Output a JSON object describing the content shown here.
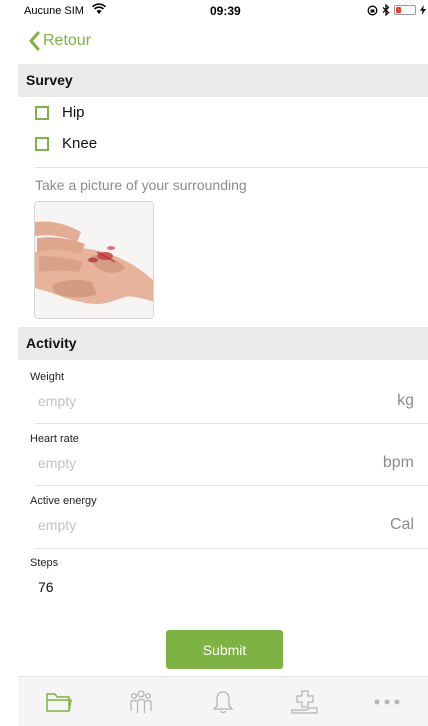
{
  "status_bar": {
    "carrier": "Aucune SIM",
    "time": "09:39",
    "battery_level": 0.2,
    "battery_color": "#ff3b30"
  },
  "nav": {
    "back_label": "Retour"
  },
  "survey": {
    "title": "Survey",
    "options": [
      {
        "label": "Hip",
        "checked": false
      },
      {
        "label": "Knee",
        "checked": false
      }
    ],
    "photo_prompt": "Take a picture of your surrounding"
  },
  "activity": {
    "title": "Activity",
    "fields": [
      {
        "label": "Weight",
        "value": "empty",
        "unit": "kg"
      },
      {
        "label": "Heart rate",
        "value": "empty",
        "unit": "bpm"
      },
      {
        "label": "Active energy",
        "value": "empty",
        "unit": "Cal"
      },
      {
        "label": "Steps",
        "value": "76",
        "unit": ""
      }
    ]
  },
  "submit_label": "Submit",
  "tabs": [
    {
      "icon": "folder-icon",
      "active": true
    },
    {
      "icon": "people-icon",
      "active": false
    },
    {
      "icon": "bell-icon",
      "active": false
    },
    {
      "icon": "medical-cross-icon",
      "active": false
    },
    {
      "icon": "more-icon",
      "active": false
    }
  ],
  "colors": {
    "accent": "#7cb342",
    "section_bg": "#ebebeb",
    "tab_inactive": "#b5b5b5"
  }
}
